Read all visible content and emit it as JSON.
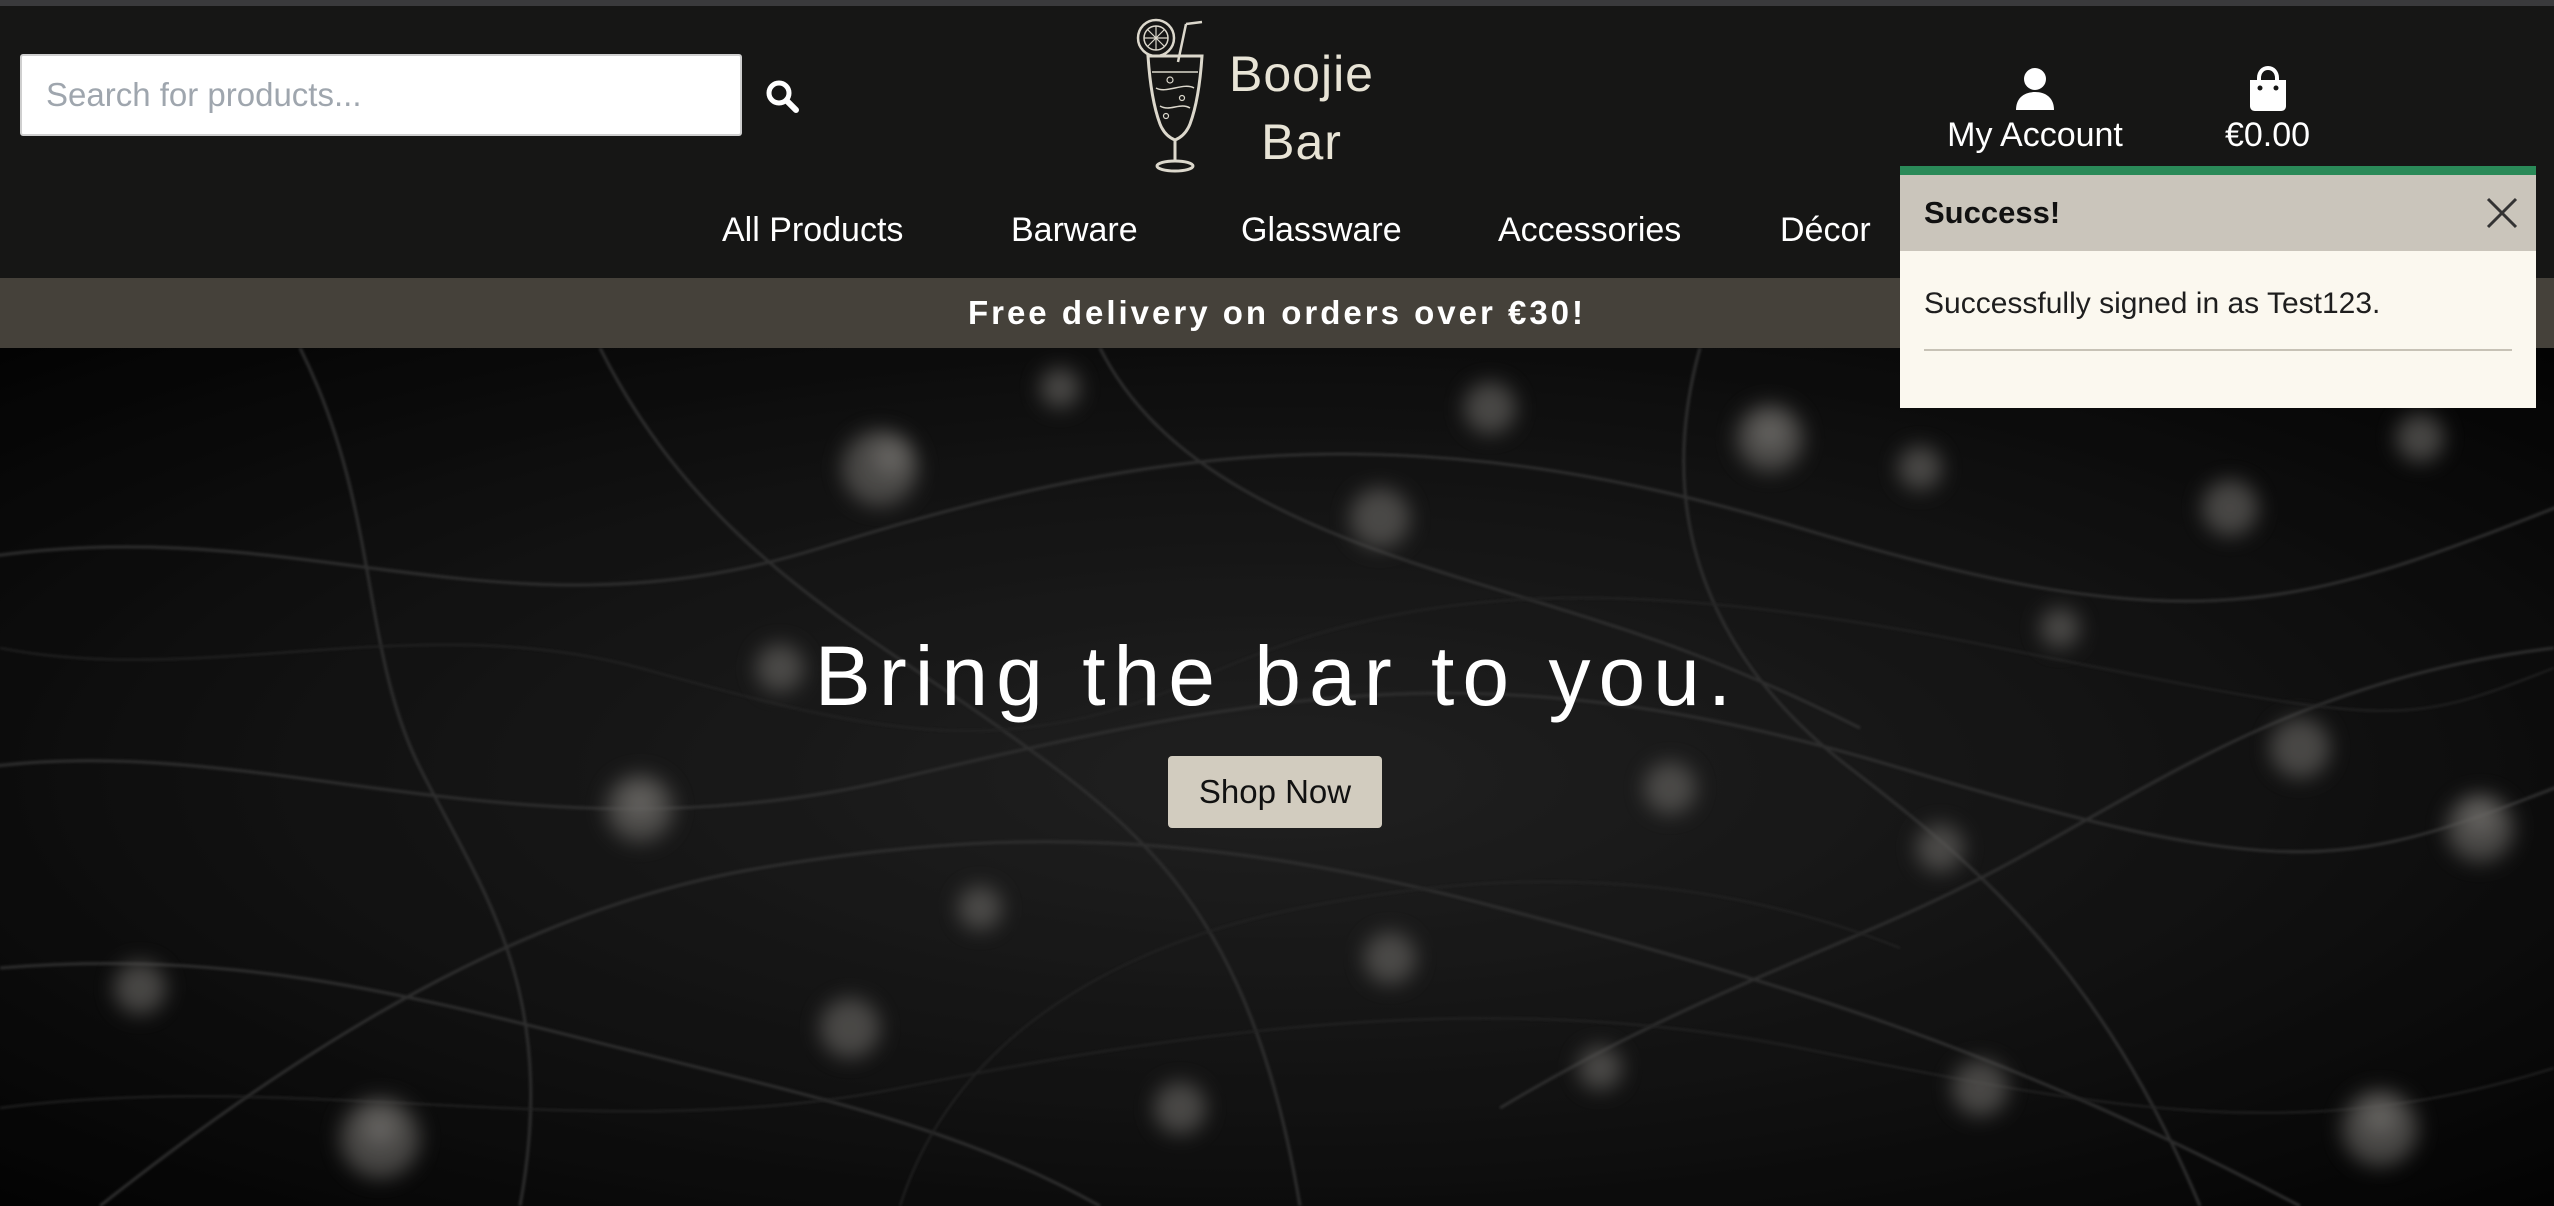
{
  "search": {
    "placeholder": "Search for products..."
  },
  "brand": {
    "line1": "Boojie",
    "line2": "Bar"
  },
  "account": {
    "label": "My Account"
  },
  "cart": {
    "total": "€0.00"
  },
  "nav": {
    "items": [
      "All Products",
      "Barware",
      "Glassware",
      "Accessories",
      "Décor"
    ]
  },
  "banner": {
    "text": "Free delivery on orders over €30!"
  },
  "hero": {
    "title": "Bring the bar to you.",
    "button_label": "Shop Now"
  },
  "toast": {
    "title": "Success!",
    "message": "Successfully signed in as Test123."
  },
  "colors": {
    "header_bg": "#161615",
    "banner_bg": "#45413a",
    "button_bg": "#d2ccbf",
    "toast_accent": "#2a8a58",
    "toast_header_bg": "#cac5bb",
    "toast_body_bg": "#fbf8ef"
  },
  "icons": {
    "search": "search-icon",
    "account": "user-icon",
    "cart": "shopping-bag-icon",
    "close": "close-icon",
    "logo": "cocktail-glass-icon"
  }
}
